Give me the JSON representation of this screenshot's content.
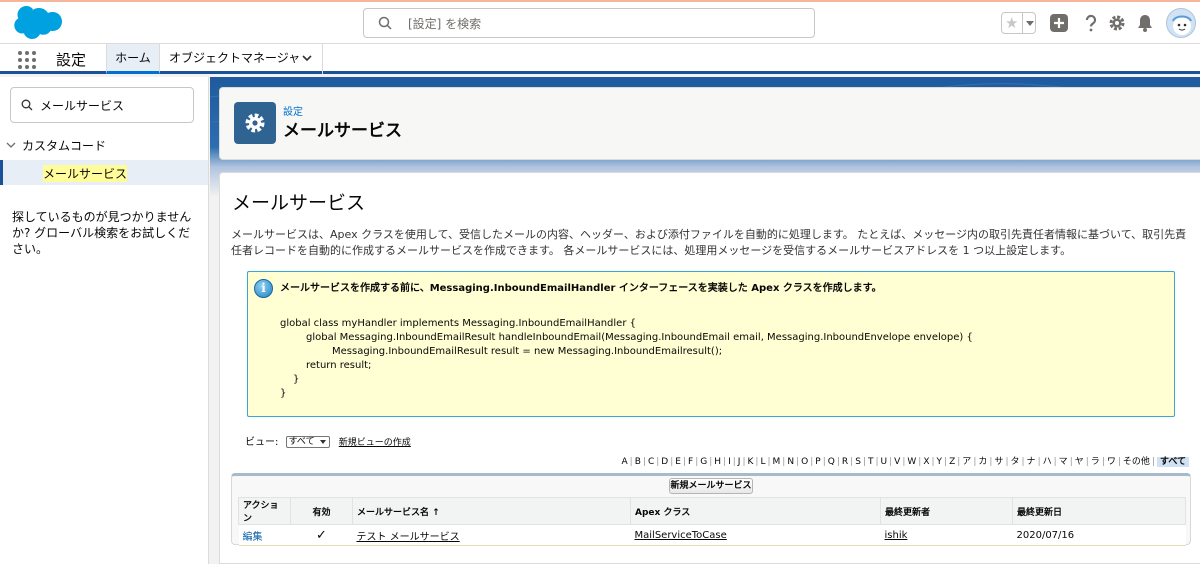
{
  "header": {
    "search_placeholder": "[設定] を検索",
    "icons": [
      "salesforce-cloud-logo",
      "star-icon",
      "plus-icon",
      "help-icon",
      "gear-icon",
      "bell-icon",
      "astro-avatar"
    ]
  },
  "nav": {
    "app_name": "設定",
    "tabs": [
      {
        "label": "ホーム",
        "active": true
      },
      {
        "label": "オブジェクトマネージャ",
        "active": false
      }
    ]
  },
  "sidebar": {
    "search_value": "メールサービス",
    "tree_head": "カスタムコード",
    "tree_item": "メールサービス",
    "note": "探しているものが見つかりませんか? グローバル検索をお試しください。"
  },
  "page_header": {
    "breadcrumb": "設定",
    "title": "メールサービス"
  },
  "main": {
    "title": "メールサービス",
    "description": "メールサービスは、Apex クラスを使用して、受信したメールの内容、ヘッダー、および添付ファイルを自動的に処理します。 たとえば、メッセージ内の取引先責任者情報に基づいて、取引先責任者レコードを自動的に作成するメールサービスを作成できます。 各メールサービスには、処理用メッセージを受信するメールサービスアドレスを 1 つ以上設定します。",
    "info_heading": "メールサービスを作成する前に、Messaging.InboundEmailHandler インターフェースを実装した Apex クラスを作成します。",
    "code_lines": [
      "global class myHandler implements Messaging.InboundEmailHandler {",
      "global Messaging.InboundEmailResult handleInboundEmail(Messaging.InboundEmail email, Messaging.InboundEnvelope envelope) {",
      "Messaging.InboundEmailResult result = new Messaging.InboundEmailresult();",
      "return result;",
      "}",
      "}"
    ],
    "view_label": "ビュー:",
    "view_selected": "すべて",
    "new_view_link": "新規ビューの作成",
    "alpha": [
      "A",
      "B",
      "C",
      "D",
      "E",
      "F",
      "G",
      "H",
      "I",
      "J",
      "K",
      "L",
      "M",
      "N",
      "O",
      "P",
      "Q",
      "R",
      "S",
      "T",
      "U",
      "V",
      "W",
      "X",
      "Y",
      "Z",
      "ア",
      "カ",
      "サ",
      "タ",
      "ナ",
      "ハ",
      "マ",
      "ヤ",
      "ラ",
      "ワ",
      "その他"
    ],
    "alpha_all": "すべて",
    "new_button": "新規メールサービス",
    "table": {
      "columns": [
        "アクション",
        "有効",
        "メールサービス名 ↑",
        "Apex クラス",
        "最終更新者",
        "最終更新日"
      ],
      "rows": [
        {
          "action": "編集",
          "active": "✓",
          "name": "テスト メールサービス",
          "apex_class": "MailServiceToCase",
          "modified_by": "ishik",
          "modified_date": "2020/07/16"
        }
      ]
    }
  }
}
